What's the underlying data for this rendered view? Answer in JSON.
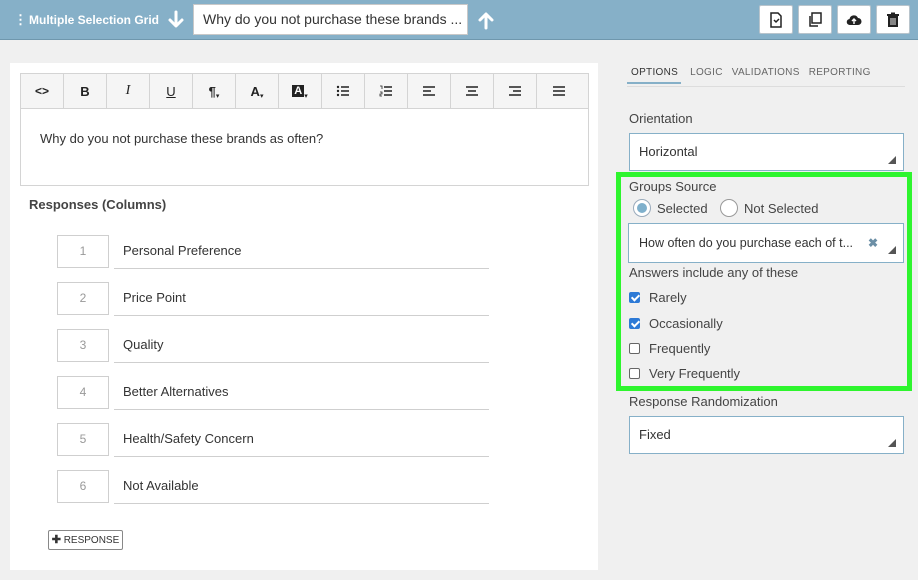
{
  "header": {
    "question_type": "Multiple Selection Grid",
    "question_title": "Why do you not purchase these brands ...",
    "buttons": {
      "preview": "preview-icon",
      "copy": "copy-icon",
      "upload": "cloud-upload-icon",
      "delete": "trash-icon"
    }
  },
  "editor": {
    "toolbar": [
      {
        "name": "code",
        "glyph": "<>"
      },
      {
        "name": "bold",
        "glyph": "B"
      },
      {
        "name": "italic",
        "glyph": "I"
      },
      {
        "name": "underline",
        "glyph": "U"
      },
      {
        "name": "paragraph",
        "glyph": "¶"
      },
      {
        "name": "font-color",
        "glyph": "A"
      },
      {
        "name": "highlight",
        "glyph": "A"
      },
      {
        "name": "bullet-list",
        "glyph": ""
      },
      {
        "name": "numbered-list",
        "glyph": ""
      },
      {
        "name": "align-left",
        "glyph": ""
      },
      {
        "name": "align-center",
        "glyph": ""
      },
      {
        "name": "align-right",
        "glyph": ""
      },
      {
        "name": "justify",
        "glyph": ""
      }
    ],
    "text": "Why do you not purchase these brands as often?"
  },
  "responses": {
    "heading": "Responses (Columns)",
    "items": [
      {
        "num": "1",
        "label": "Personal Preference"
      },
      {
        "num": "2",
        "label": "Price Point"
      },
      {
        "num": "3",
        "label": "Quality"
      },
      {
        "num": "4",
        "label": "Better Alternatives"
      },
      {
        "num": "5",
        "label": "Health/Safety Concern"
      },
      {
        "num": "6",
        "label": "Not Available"
      }
    ],
    "add_label": "RESPONSE"
  },
  "settings": {
    "tabs": [
      "OPTIONS",
      "LOGIC",
      "VALIDATIONS",
      "REPORTING"
    ],
    "active_tab": "OPTIONS",
    "orientation_label": "Orientation",
    "orientation_value": "Horizontal",
    "groups_source_label": "Groups Source",
    "groups_source_options": [
      "Selected",
      "Not Selected"
    ],
    "groups_source_selected": "Selected",
    "groups_source_question": "How often do you purchase each of t...",
    "answers_label": "Answers include any of these",
    "answers": [
      {
        "label": "Rarely",
        "checked": true
      },
      {
        "label": "Occasionally",
        "checked": true
      },
      {
        "label": "Frequently",
        "checked": false
      },
      {
        "label": "Very Frequently",
        "checked": false
      }
    ],
    "randomization_label": "Response Randomization",
    "randomization_value": "Fixed"
  },
  "colors": {
    "header_bg": "#86b0c8",
    "highlight_border": "#2ef52e",
    "checkbox_checked": "#2d7ad6"
  }
}
